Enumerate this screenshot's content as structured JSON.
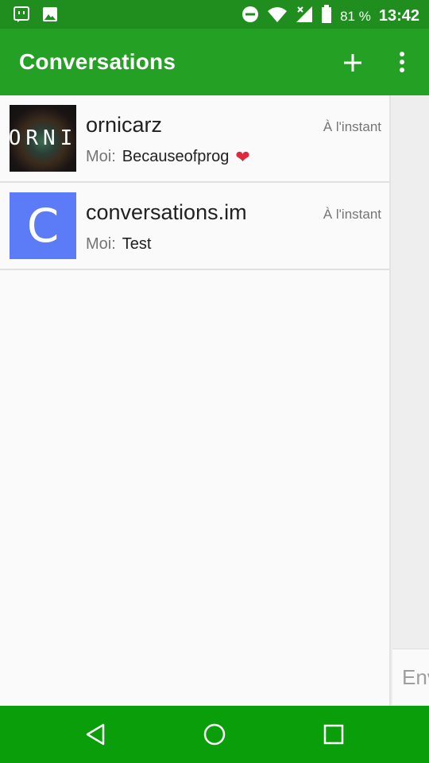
{
  "status_bar": {
    "battery_percent": "81 %",
    "time": "13:42",
    "icons": [
      "notification-app-icon",
      "image-icon",
      "do-not-disturb-icon",
      "wifi-icon",
      "cellular-no-signal-icon",
      "battery-icon"
    ]
  },
  "app_bar": {
    "title": "Conversations",
    "actions": [
      "add-icon",
      "more-vert-icon"
    ]
  },
  "conversations": [
    {
      "name": "ornicarz",
      "avatar_text": "ORNI",
      "time": "À l'instant",
      "sender": "Moi:",
      "message": "Becauseofprog",
      "emoji": "❤"
    },
    {
      "name": "conversations.im",
      "avatar_text": "C",
      "avatar_color": "#5b7cf6",
      "time": "À l'instant",
      "sender": "Moi:",
      "message": "Test"
    }
  ],
  "side_panel": {
    "compose_placeholder": "Env"
  },
  "colors": {
    "status_bar": "#1f8e1f",
    "app_bar": "#24a024",
    "nav_bar": "#0a9e0a"
  },
  "nav_bar": [
    "back-icon",
    "home-icon",
    "recents-icon"
  ]
}
